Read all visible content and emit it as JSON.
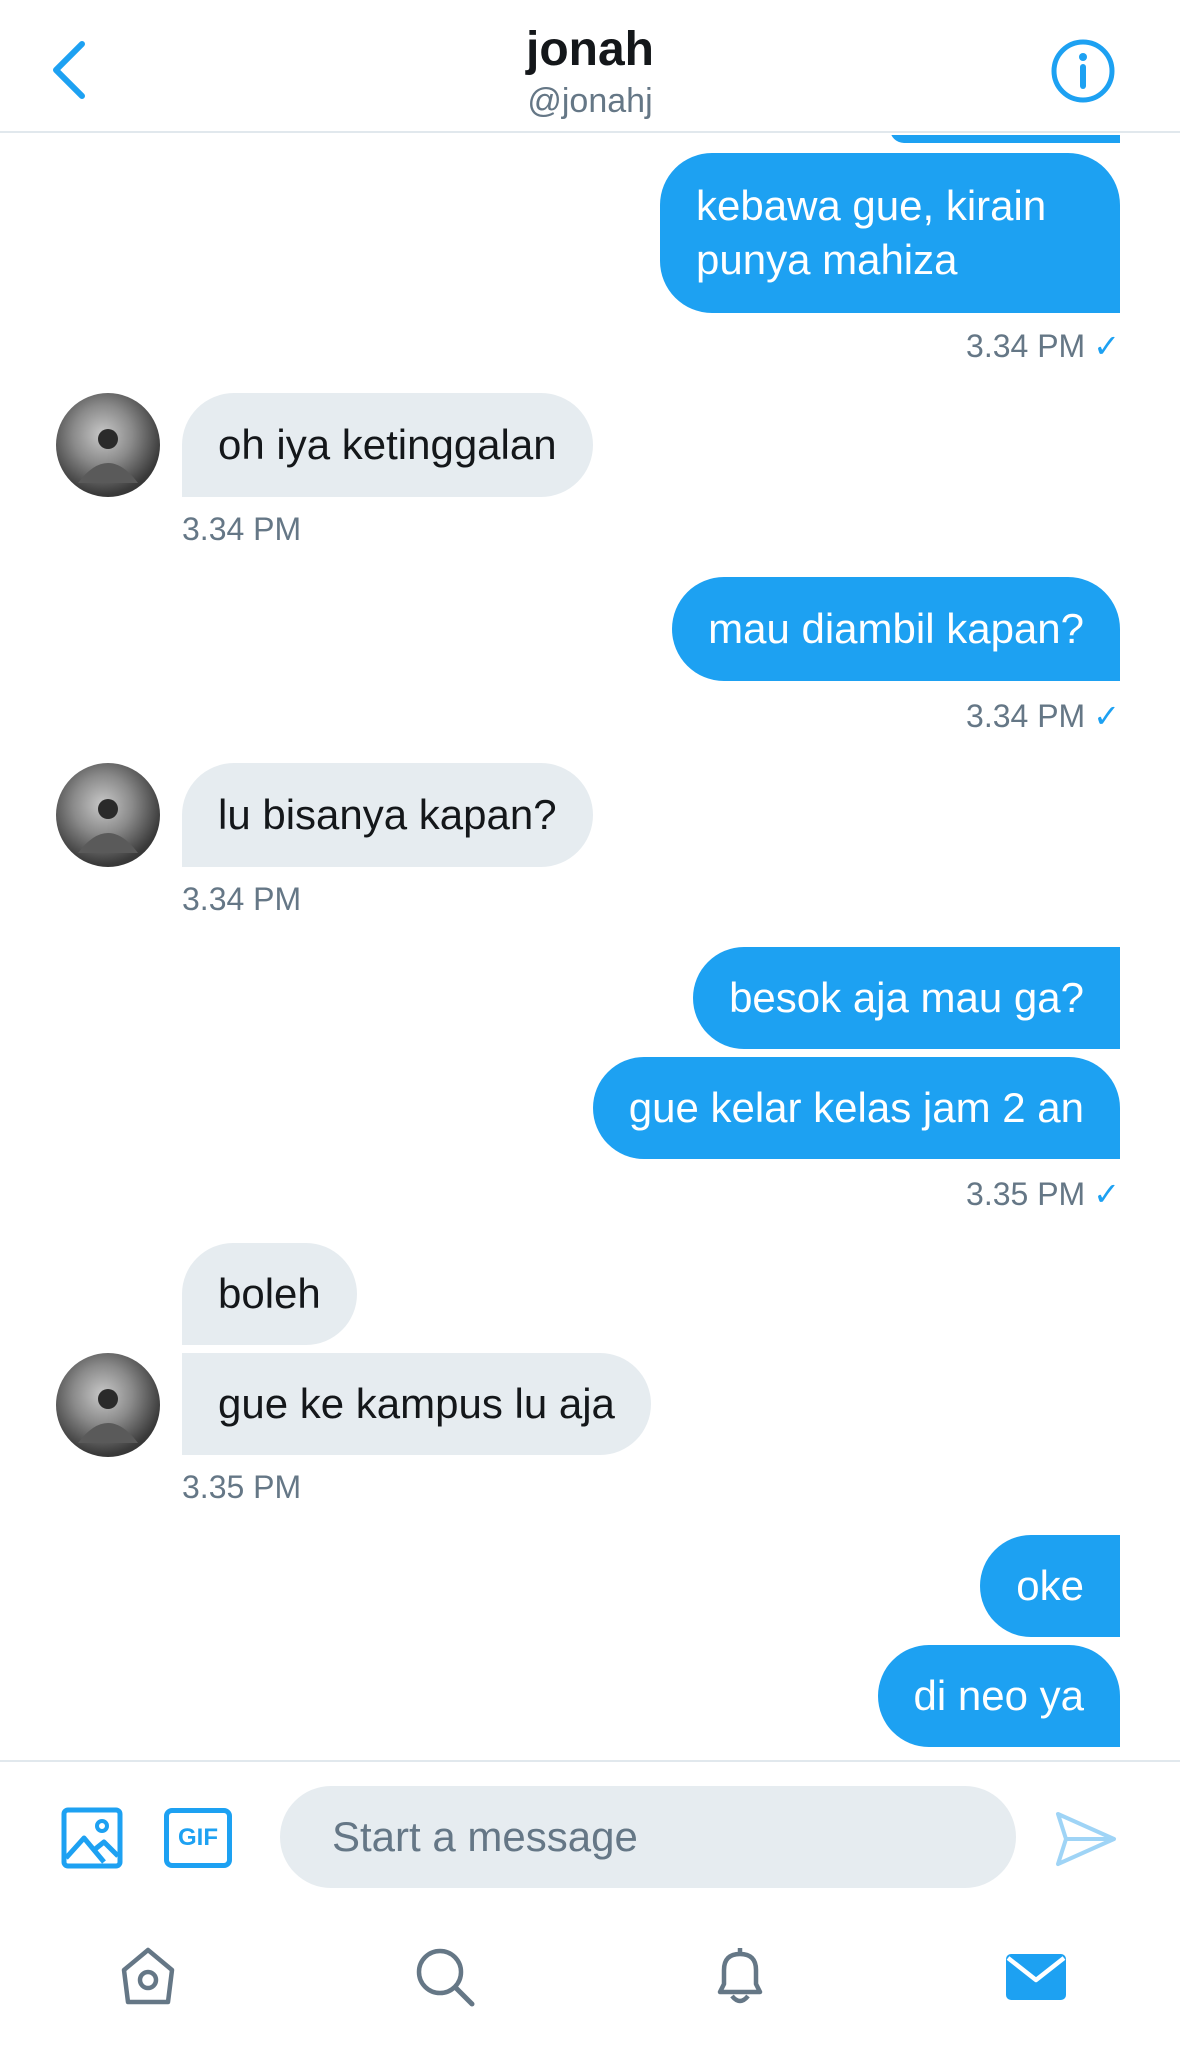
{
  "header": {
    "title": "jonah",
    "handle": "@jonahj"
  },
  "messages": [
    {
      "from": "me",
      "text_lines": [
        "kebawa gue, kirain",
        "punya mahiza"
      ]
    },
    {
      "from": "me",
      "time": "3.34 PM",
      "read": true
    },
    {
      "from": "them",
      "text": "oh iya ketinggalan",
      "time": "3.34 PM"
    },
    {
      "from": "me",
      "text": "mau diambil kapan?",
      "time": "3.34 PM",
      "read": true
    },
    {
      "from": "them",
      "text": "lu bisanya kapan?",
      "time": "3.34 PM"
    },
    {
      "from": "me",
      "text": "besok aja mau ga?"
    },
    {
      "from": "me",
      "text": "gue kelar kelas jam 2 an",
      "time": "3.35 PM",
      "read": true
    },
    {
      "from": "them",
      "text": "boleh"
    },
    {
      "from": "them",
      "text": "gue ke kampus lu aja",
      "time": "3.35 PM"
    },
    {
      "from": "me",
      "text": "oke"
    },
    {
      "from": "me",
      "text": "di neo ya"
    }
  ],
  "composer": {
    "placeholder": "Start a message",
    "gif_label": "GIF"
  },
  "read_mark": "✓",
  "colors": {
    "accent": "#1da1f2",
    "incoming_bubble": "#e6ecf0",
    "secondary_text": "#657786"
  },
  "icons": {
    "back": "chevron-left-icon",
    "info": "info-icon",
    "image": "image-icon",
    "send": "send-icon",
    "home": "home-icon",
    "search": "search-icon",
    "notifications": "bell-icon",
    "messages": "mail-icon"
  }
}
